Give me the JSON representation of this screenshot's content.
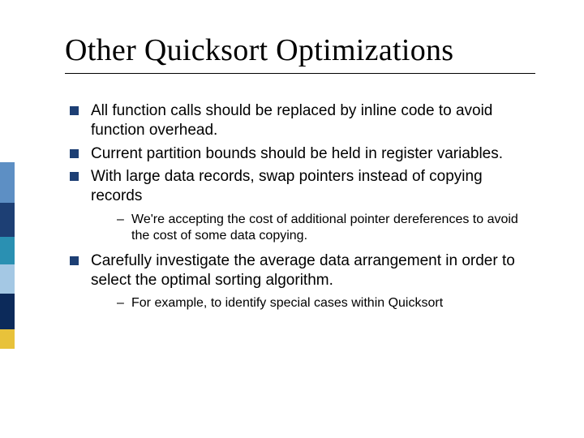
{
  "title": "Other Quicksort Optimizations",
  "bullets": [
    {
      "text": "All function calls should be replaced by inline code to avoid function overhead."
    },
    {
      "text": "Current partition bounds should be held in register variables."
    },
    {
      "text": "With large data records, swap pointers instead of copying records",
      "sub": [
        "We're accepting the cost of additional pointer dereferences to avoid the cost of some data copying."
      ]
    },
    {
      "text": "Carefully investigate the average data arrangement in order to select the optimal sorting algorithm.",
      "sub": [
        "For example, to identify special cases within Quicksort"
      ]
    }
  ]
}
